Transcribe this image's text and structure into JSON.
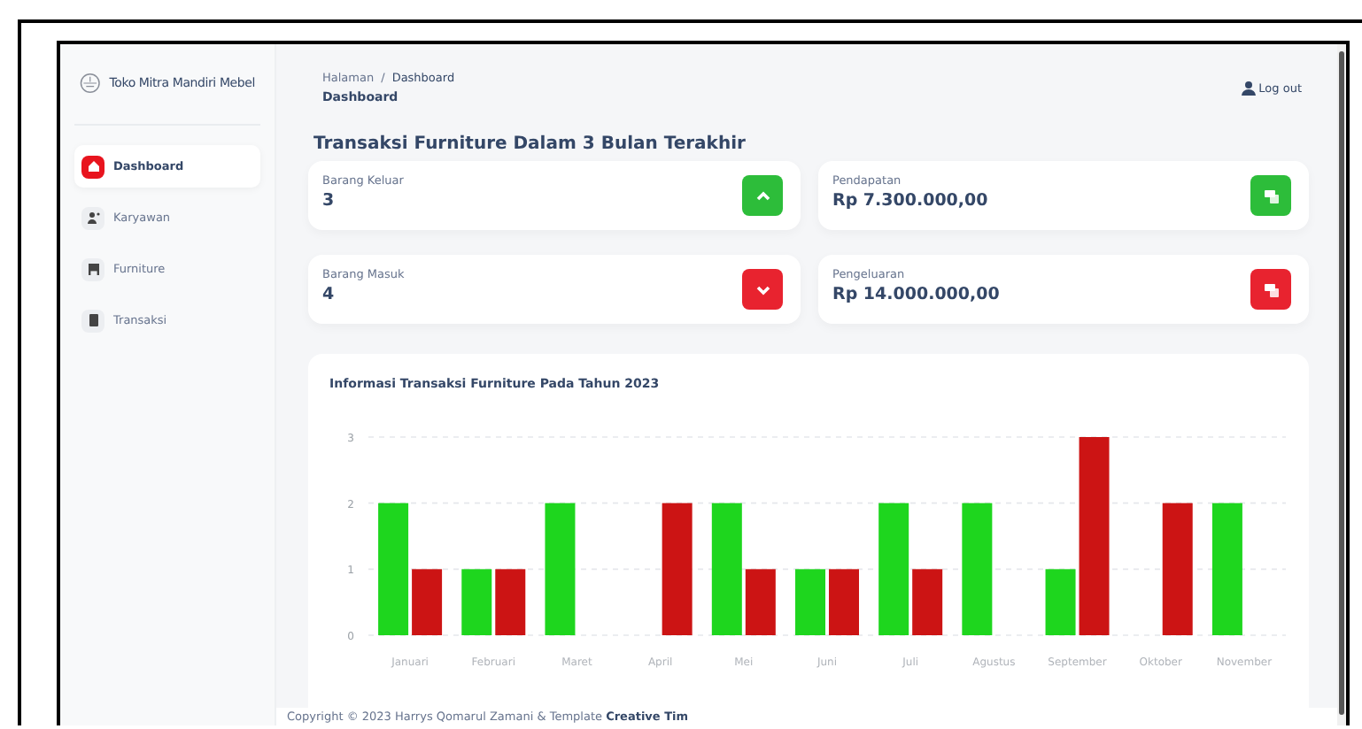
{
  "sidebar": {
    "brand": "Toko Mitra Mandiri Mebel",
    "items": [
      {
        "label": "Dashboard",
        "selected": true
      },
      {
        "label": "Karyawan",
        "selected": false
      },
      {
        "label": "Furniture",
        "selected": false
      },
      {
        "label": "Transaksi",
        "selected": false
      }
    ]
  },
  "header": {
    "breadcrumb": [
      "Halaman",
      "Dashboard"
    ],
    "separator": "/",
    "page_title": "Dashboard",
    "logout": "Log out"
  },
  "section_title": "Transaksi Furniture Dalam 3 Bulan Terakhir",
  "stats": [
    {
      "label": "Barang Keluar",
      "value": "3",
      "kind": "arrow_up",
      "color": "#2dbd3a"
    },
    {
      "label": "Pendapatan",
      "value": "Rp 7.300.000,00",
      "kind": "money",
      "color": "#2dbd3a"
    },
    {
      "label": "Barang Masuk",
      "value": "4",
      "kind": "arrow_down",
      "color": "#e8232f"
    },
    {
      "label": "Pengeluaran",
      "value": "Rp 14.000.000,00",
      "kind": "money",
      "color": "#e8232f"
    }
  ],
  "chart": {
    "chart_data": {
      "type": "bar",
      "title": "Informasi Transaksi Furniture Pada Tahun 2023",
      "categories": [
        "Januari",
        "Februari",
        "Maret",
        "April",
        "Mei",
        "Juni",
        "Juli",
        "Agustus",
        "September",
        "Oktober",
        "November"
      ],
      "series": [
        {
          "color": "#1ed61e",
          "values": [
            2,
            1,
            2,
            0,
            2,
            1,
            2,
            2,
            1,
            0,
            2
          ]
        },
        {
          "color": "#cc1414",
          "values": [
            1,
            1,
            0,
            2,
            1,
            1,
            1,
            0,
            3,
            2,
            0
          ]
        }
      ],
      "ylim": [
        0,
        3
      ],
      "yticks": [
        0,
        1,
        2,
        3
      ]
    }
  },
  "footer": {
    "text": "Copyright © 2023 Harrys Qomarul Zamani & Template",
    "link": "Creative Tim"
  }
}
